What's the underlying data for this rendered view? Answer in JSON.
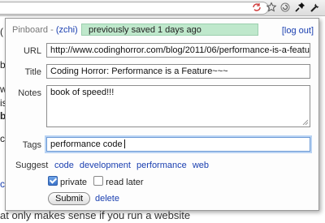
{
  "popup": {
    "header_prefix": "Pinboard - ",
    "username": "(zchi)",
    "saved_notice": "previously saved 1 days ago",
    "logout_label": "log out",
    "url_label": "URL",
    "url_value": "http://www.codinghorror.com/blog/2011/06/performance-is-a-featu",
    "title_label": "Title",
    "title_value": "Coding Horror: Performance is a Feature~~~",
    "notes_label": "Notes",
    "notes_value": "book of speed!!!",
    "tags_label": "Tags",
    "tags_value": "performance code",
    "suggest_label": "Suggest",
    "suggested_tags": [
      "code",
      "development",
      "performance",
      "web"
    ],
    "private_label": "private",
    "private_checked": true,
    "read_later_label": "read later",
    "read_later_checked": false,
    "submit_label": "Submit",
    "delete_label": "delete"
  },
  "background": {
    "bottom_text": "at only makes sense if you run a website",
    "fragments": [
      "(",
      "b",
      "w",
      "is",
      "b",
      "c",
      "c"
    ]
  },
  "toolbar_icons": [
    "sync-icon",
    "star-icon",
    "reload-icon",
    "pin-icon",
    "wrench-icon"
  ]
}
